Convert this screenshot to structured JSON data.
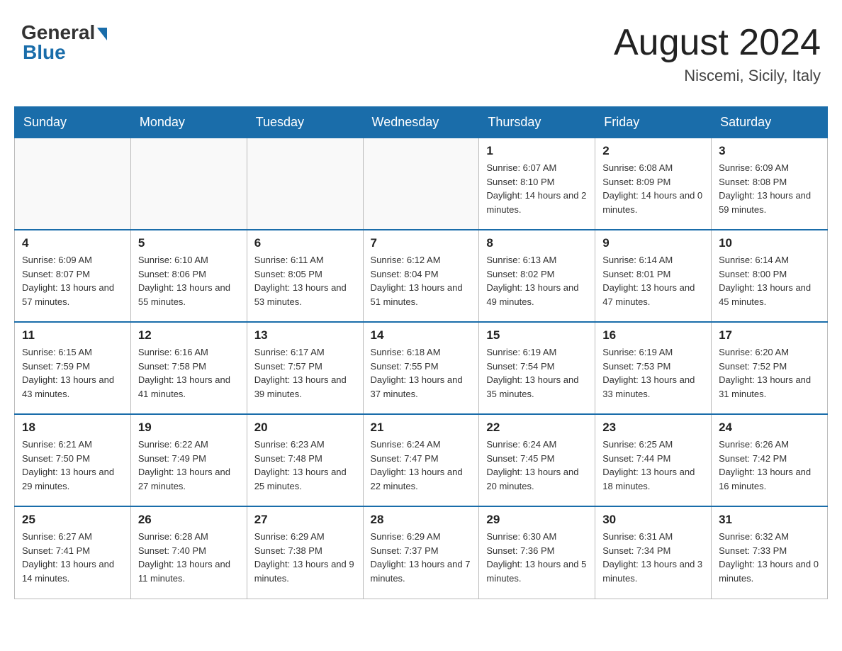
{
  "header": {
    "logo_general": "General",
    "logo_blue": "Blue",
    "title": "August 2024",
    "location": "Niscemi, Sicily, Italy"
  },
  "days_of_week": [
    "Sunday",
    "Monday",
    "Tuesday",
    "Wednesday",
    "Thursday",
    "Friday",
    "Saturday"
  ],
  "weeks": [
    [
      {
        "day": "",
        "sunrise": "",
        "sunset": "",
        "daylight": ""
      },
      {
        "day": "",
        "sunrise": "",
        "sunset": "",
        "daylight": ""
      },
      {
        "day": "",
        "sunrise": "",
        "sunset": "",
        "daylight": ""
      },
      {
        "day": "",
        "sunrise": "",
        "sunset": "",
        "daylight": ""
      },
      {
        "day": "1",
        "sunrise": "Sunrise: 6:07 AM",
        "sunset": "Sunset: 8:10 PM",
        "daylight": "Daylight: 14 hours and 2 minutes."
      },
      {
        "day": "2",
        "sunrise": "Sunrise: 6:08 AM",
        "sunset": "Sunset: 8:09 PM",
        "daylight": "Daylight: 14 hours and 0 minutes."
      },
      {
        "day": "3",
        "sunrise": "Sunrise: 6:09 AM",
        "sunset": "Sunset: 8:08 PM",
        "daylight": "Daylight: 13 hours and 59 minutes."
      }
    ],
    [
      {
        "day": "4",
        "sunrise": "Sunrise: 6:09 AM",
        "sunset": "Sunset: 8:07 PM",
        "daylight": "Daylight: 13 hours and 57 minutes."
      },
      {
        "day": "5",
        "sunrise": "Sunrise: 6:10 AM",
        "sunset": "Sunset: 8:06 PM",
        "daylight": "Daylight: 13 hours and 55 minutes."
      },
      {
        "day": "6",
        "sunrise": "Sunrise: 6:11 AM",
        "sunset": "Sunset: 8:05 PM",
        "daylight": "Daylight: 13 hours and 53 minutes."
      },
      {
        "day": "7",
        "sunrise": "Sunrise: 6:12 AM",
        "sunset": "Sunset: 8:04 PM",
        "daylight": "Daylight: 13 hours and 51 minutes."
      },
      {
        "day": "8",
        "sunrise": "Sunrise: 6:13 AM",
        "sunset": "Sunset: 8:02 PM",
        "daylight": "Daylight: 13 hours and 49 minutes."
      },
      {
        "day": "9",
        "sunrise": "Sunrise: 6:14 AM",
        "sunset": "Sunset: 8:01 PM",
        "daylight": "Daylight: 13 hours and 47 minutes."
      },
      {
        "day": "10",
        "sunrise": "Sunrise: 6:14 AM",
        "sunset": "Sunset: 8:00 PM",
        "daylight": "Daylight: 13 hours and 45 minutes."
      }
    ],
    [
      {
        "day": "11",
        "sunrise": "Sunrise: 6:15 AM",
        "sunset": "Sunset: 7:59 PM",
        "daylight": "Daylight: 13 hours and 43 minutes."
      },
      {
        "day": "12",
        "sunrise": "Sunrise: 6:16 AM",
        "sunset": "Sunset: 7:58 PM",
        "daylight": "Daylight: 13 hours and 41 minutes."
      },
      {
        "day": "13",
        "sunrise": "Sunrise: 6:17 AM",
        "sunset": "Sunset: 7:57 PM",
        "daylight": "Daylight: 13 hours and 39 minutes."
      },
      {
        "day": "14",
        "sunrise": "Sunrise: 6:18 AM",
        "sunset": "Sunset: 7:55 PM",
        "daylight": "Daylight: 13 hours and 37 minutes."
      },
      {
        "day": "15",
        "sunrise": "Sunrise: 6:19 AM",
        "sunset": "Sunset: 7:54 PM",
        "daylight": "Daylight: 13 hours and 35 minutes."
      },
      {
        "day": "16",
        "sunrise": "Sunrise: 6:19 AM",
        "sunset": "Sunset: 7:53 PM",
        "daylight": "Daylight: 13 hours and 33 minutes."
      },
      {
        "day": "17",
        "sunrise": "Sunrise: 6:20 AM",
        "sunset": "Sunset: 7:52 PM",
        "daylight": "Daylight: 13 hours and 31 minutes."
      }
    ],
    [
      {
        "day": "18",
        "sunrise": "Sunrise: 6:21 AM",
        "sunset": "Sunset: 7:50 PM",
        "daylight": "Daylight: 13 hours and 29 minutes."
      },
      {
        "day": "19",
        "sunrise": "Sunrise: 6:22 AM",
        "sunset": "Sunset: 7:49 PM",
        "daylight": "Daylight: 13 hours and 27 minutes."
      },
      {
        "day": "20",
        "sunrise": "Sunrise: 6:23 AM",
        "sunset": "Sunset: 7:48 PM",
        "daylight": "Daylight: 13 hours and 25 minutes."
      },
      {
        "day": "21",
        "sunrise": "Sunrise: 6:24 AM",
        "sunset": "Sunset: 7:47 PM",
        "daylight": "Daylight: 13 hours and 22 minutes."
      },
      {
        "day": "22",
        "sunrise": "Sunrise: 6:24 AM",
        "sunset": "Sunset: 7:45 PM",
        "daylight": "Daylight: 13 hours and 20 minutes."
      },
      {
        "day": "23",
        "sunrise": "Sunrise: 6:25 AM",
        "sunset": "Sunset: 7:44 PM",
        "daylight": "Daylight: 13 hours and 18 minutes."
      },
      {
        "day": "24",
        "sunrise": "Sunrise: 6:26 AM",
        "sunset": "Sunset: 7:42 PM",
        "daylight": "Daylight: 13 hours and 16 minutes."
      }
    ],
    [
      {
        "day": "25",
        "sunrise": "Sunrise: 6:27 AM",
        "sunset": "Sunset: 7:41 PM",
        "daylight": "Daylight: 13 hours and 14 minutes."
      },
      {
        "day": "26",
        "sunrise": "Sunrise: 6:28 AM",
        "sunset": "Sunset: 7:40 PM",
        "daylight": "Daylight: 13 hours and 11 minutes."
      },
      {
        "day": "27",
        "sunrise": "Sunrise: 6:29 AM",
        "sunset": "Sunset: 7:38 PM",
        "daylight": "Daylight: 13 hours and 9 minutes."
      },
      {
        "day": "28",
        "sunrise": "Sunrise: 6:29 AM",
        "sunset": "Sunset: 7:37 PM",
        "daylight": "Daylight: 13 hours and 7 minutes."
      },
      {
        "day": "29",
        "sunrise": "Sunrise: 6:30 AM",
        "sunset": "Sunset: 7:36 PM",
        "daylight": "Daylight: 13 hours and 5 minutes."
      },
      {
        "day": "30",
        "sunrise": "Sunrise: 6:31 AM",
        "sunset": "Sunset: 7:34 PM",
        "daylight": "Daylight: 13 hours and 3 minutes."
      },
      {
        "day": "31",
        "sunrise": "Sunrise: 6:32 AM",
        "sunset": "Sunset: 7:33 PM",
        "daylight": "Daylight: 13 hours and 0 minutes."
      }
    ]
  ]
}
